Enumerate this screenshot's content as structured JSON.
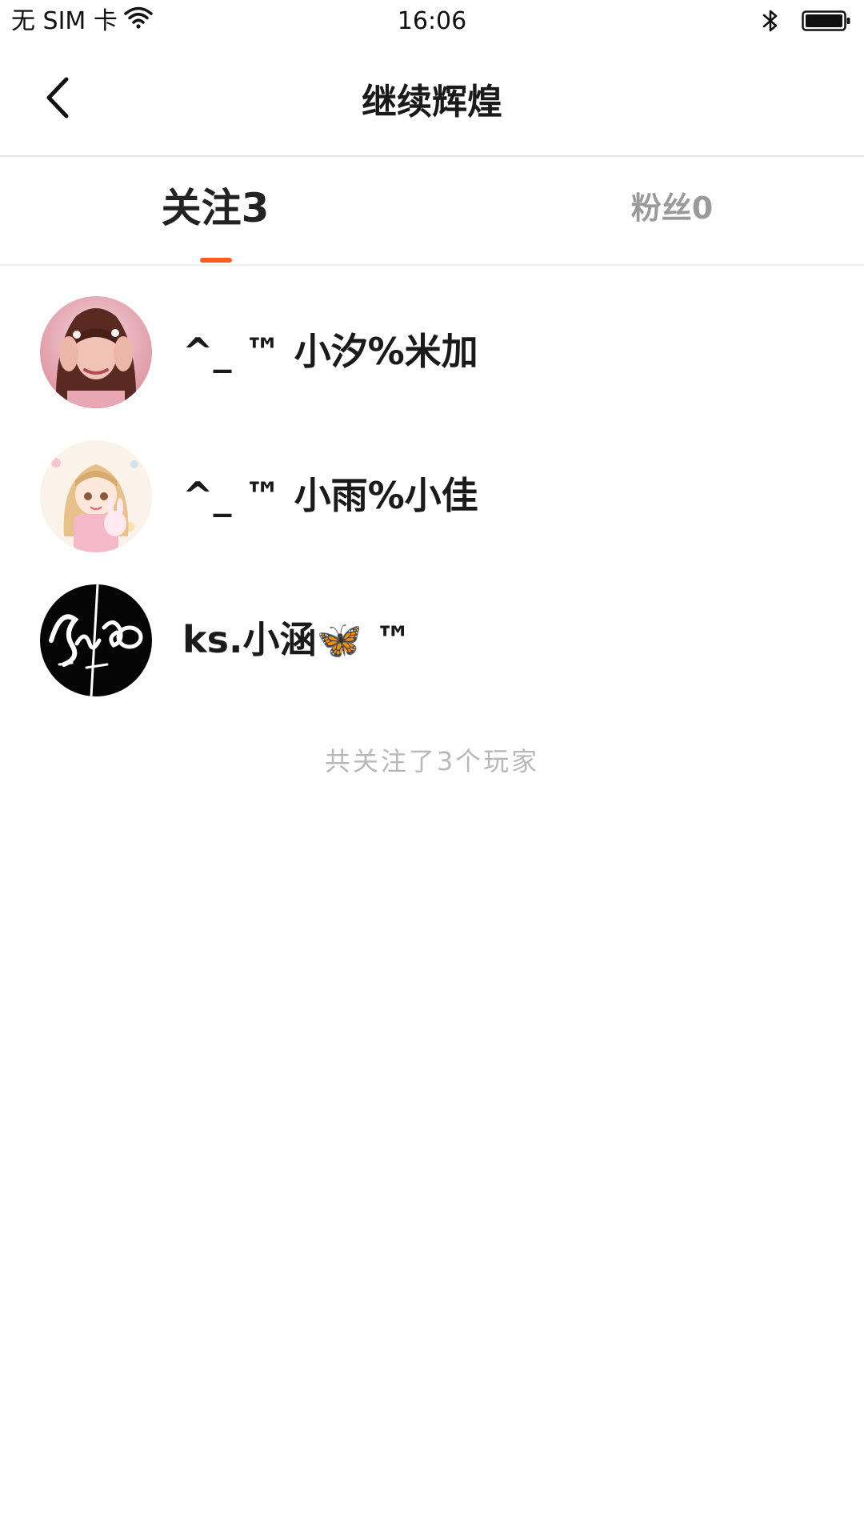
{
  "status_bar": {
    "carrier": "无 SIM 卡",
    "time": "16:06",
    "icons": [
      "wifi-icon",
      "bluetooth-icon",
      "battery-icon"
    ]
  },
  "nav": {
    "title": "继续辉煌",
    "back_icon": "chevron-left-icon"
  },
  "tabs": [
    {
      "label": "关注3",
      "active": true
    },
    {
      "label": "粉丝0",
      "active": false
    }
  ],
  "following": [
    {
      "name": "^_ ™ 小汐%米加",
      "avatar": "avatar-girl-pink-photo"
    },
    {
      "name": "^_ ™ 小雨%小佳",
      "avatar": "avatar-anime-girl-bunny"
    },
    {
      "name": "ks.小涵🦋 ™",
      "avatar": "avatar-black-signature-logo"
    }
  ],
  "summary": "共关注了3个玩家",
  "colors": {
    "accent": "#ff5a1f",
    "text": "#1a1a1a",
    "muted": "#9a9a9a",
    "summary": "#b8b8b8",
    "divider": "#e2e2e2"
  }
}
